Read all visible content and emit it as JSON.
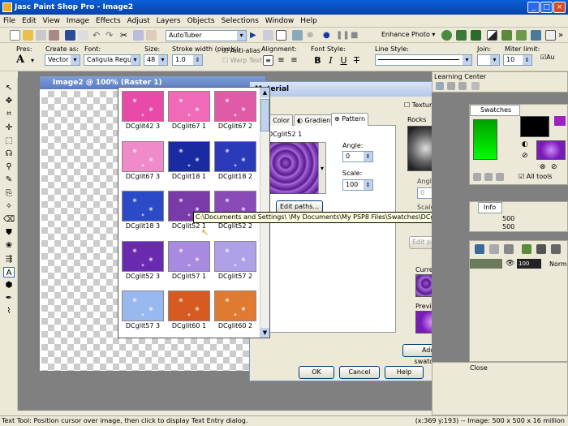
{
  "app": {
    "title": "Jasc Paint Shop Pro - Image2"
  },
  "menu": [
    "File",
    "Edit",
    "View",
    "Image",
    "Effects",
    "Adjust",
    "Layers",
    "Objects",
    "Selections",
    "Window",
    "Help"
  ],
  "toolbar": {
    "script_value": "AutoTuber",
    "enhance_label": "Enhance Photo ▾"
  },
  "tool_options": {
    "presets_label": "Pres:",
    "create_as_label": "Create as:",
    "create_as_value": "Vector",
    "font_label": "Font:",
    "font_value": "Caligula Regular",
    "size_label": "Size:",
    "size_value": "48",
    "stroke_label": "Stroke width (pixels):",
    "stroke_value": "1.0",
    "antialias_label": "Anti-alias",
    "warp_label": "Warp Text",
    "alignment_label": "Alignment:",
    "font_style_label": "Font Style:",
    "line_style_label": "Line Style:",
    "join_label": "Join:",
    "miter_label": "Miter limit:",
    "miter_value": "10",
    "auto_label": "Au"
  },
  "image_window": {
    "title": "Image2 @ 100% (Raster 1)"
  },
  "dialog": {
    "title": "Material",
    "tabs": [
      "Color",
      "Gradient",
      "Pattern"
    ],
    "current_pattern": "DCglit52 1",
    "angle_label": "Angle:",
    "angle_value": "0",
    "scale_label": "Scale:",
    "scale_value": "100",
    "edit_paths_label": "Edit paths...",
    "texture_label": "Texture",
    "texture_name": "Rocks",
    "tex_angle_label": "Angle:",
    "tex_angle_value": "0",
    "tex_scale_label": "Scale:",
    "tex_edit_paths_label": "Edit paths...",
    "current_label": "Current:",
    "previous_label": "Previous:",
    "add_swatches_label": "Add to swatches...",
    "ok_label": "OK",
    "cancel_label": "Cancel",
    "help_label": "Help"
  },
  "patterns": [
    {
      "label": "DCglit42 3",
      "color": "#e84aa8"
    },
    {
      "label": "DCglit67 1",
      "color": "#f06ab8"
    },
    {
      "label": "DCglit67 2",
      "color": "#e05aa8"
    },
    {
      "label": "DCglit67 3",
      "color": "#f08ac8"
    },
    {
      "label": "DCglit18 1",
      "color": "#1a2aa0"
    },
    {
      "label": "DCglit18 2",
      "color": "#2a3ab8"
    },
    {
      "label": "DCglit18 3",
      "color": "#2a4ac8"
    },
    {
      "label": "DCglit52 1",
      "color": "#7a3aa8"
    },
    {
      "label": "DCglit52 2",
      "color": "#8a4ab8"
    },
    {
      "label": "DCglit52 3",
      "color": "#6a2ab0"
    },
    {
      "label": "DCglit57 1",
      "color": "#a88ae0"
    },
    {
      "label": "DCglit57 2",
      "color": "#b0a0e8"
    },
    {
      "label": "DCglit57 3",
      "color": "#9ab8f0"
    },
    {
      "label": "DCglit60 1",
      "color": "#d85a20"
    },
    {
      "label": "DCglit60 2",
      "color": "#e07a30"
    }
  ],
  "tooltip": "C:\\Documents and Settings\\              \\My Documents\\My PSP8 Files\\Swatches\\DCglit52 1.iff",
  "right": {
    "learning_center": "Learning Center",
    "swatches_tab": "Swatches",
    "all_tools_label": "All tools",
    "info_tab": "Info",
    "info_v1": "500",
    "info_v2": "500",
    "layer_opacity": "100",
    "layer_mode": "Norm",
    "close_label": "Close"
  },
  "status": {
    "left": "Text Tool: Position cursor over image, then click to display Text Entry dialog.",
    "right": "(x:369 y:193) -- Image: 500 x 500 x 16 million"
  }
}
